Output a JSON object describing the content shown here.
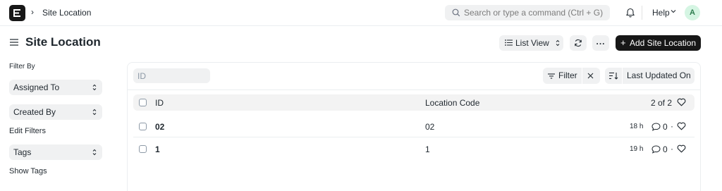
{
  "navbar": {
    "breadcrumb": "Site Location",
    "search_placeholder": "Search or type a command (Ctrl + G)",
    "help_label": "Help",
    "avatar_initial": "A"
  },
  "page": {
    "title": "Site Location",
    "list_view_label": "List View",
    "more_label": "...",
    "add_label": "Add Site Location"
  },
  "sidebar": {
    "filter_by_label": "Filter By",
    "assigned_to_label": "Assigned To",
    "created_by_label": "Created By",
    "edit_filters_label": "Edit Filters",
    "tags_label": "Tags",
    "show_tags_label": "Show Tags"
  },
  "list": {
    "id_filter_placeholder": "ID",
    "filter_label": "Filter",
    "sort_label": "Last Updated On",
    "columns": [
      "ID",
      "Location Code"
    ],
    "count_label": "2 of 2",
    "rows": [
      {
        "id": "02",
        "location_code": "02",
        "modified": "18 h",
        "comments": "0"
      },
      {
        "id": "1",
        "location_code": "1",
        "modified": "19 h",
        "comments": "0"
      }
    ]
  }
}
